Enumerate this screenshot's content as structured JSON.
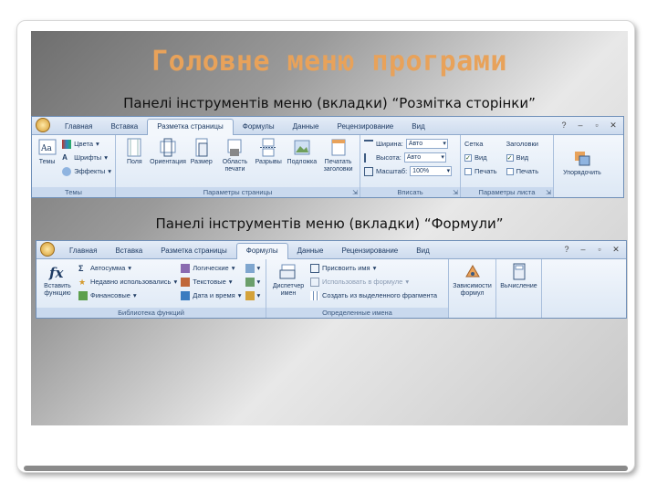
{
  "slide": {
    "title": "Головне меню програми",
    "subtitle1": "Панелі інструментів меню (вкладки) “Розмітка сторінки”",
    "subtitle2": "Панелі інструментів меню (вкладки) “Формули”"
  },
  "ribbon1": {
    "tabs": [
      "Главная",
      "Вставка",
      "Разметка страницы",
      "Формулы",
      "Данные",
      "Рецензирование",
      "Вид"
    ],
    "active_tab": 2,
    "themes": {
      "label": "Темы",
      "big": "Темы",
      "colors": "Цвета",
      "fonts": "Шрифты",
      "effects": "Эффекты"
    },
    "page_setup": {
      "label": "Параметры страницы",
      "buttons": [
        "Поля",
        "Ориентация",
        "Размер",
        "Область печати",
        "Разрывы",
        "Подложка",
        "Печатать заголовки"
      ]
    },
    "fit": {
      "label": "Вписать",
      "width": "Ширина:",
      "width_val": "Авто",
      "height": "Высота:",
      "height_val": "Авто",
      "scale": "Масштаб:",
      "scale_val": "100%"
    },
    "sheet": {
      "label": "Параметры листа",
      "grid": "Сетка",
      "headings": "Заголовки",
      "view1": "Вид",
      "view2": "Вид",
      "print1": "Печать",
      "print2": "Печать"
    },
    "arrange": {
      "label": "Упорядочить"
    }
  },
  "ribbon2": {
    "tabs": [
      "Главная",
      "Вставка",
      "Разметка страницы",
      "Формулы",
      "Данные",
      "Рецензирование",
      "Вид"
    ],
    "active_tab": 3,
    "library": {
      "label": "Библиотека функций",
      "insert": "Вставить функцию",
      "col1": [
        "Автосумма",
        "Недавно использовались",
        "Финансовые"
      ],
      "col2": [
        "Логические",
        "Текстовые",
        "Дата и время"
      ]
    },
    "names": {
      "label": "Определенные имена",
      "manager": "Диспетчер имен",
      "items": [
        "Присвоить имя",
        "Использовать в формуле",
        "Создать из выделенного фрагмента"
      ]
    },
    "audit": {
      "label": "Зависимости формул"
    },
    "calc": {
      "label": "Вычисление"
    }
  },
  "colors": {
    "title": "#e8a25a",
    "ribbon_bg": "#dbe6f4",
    "ribbon_border": "#6f8fb8"
  }
}
